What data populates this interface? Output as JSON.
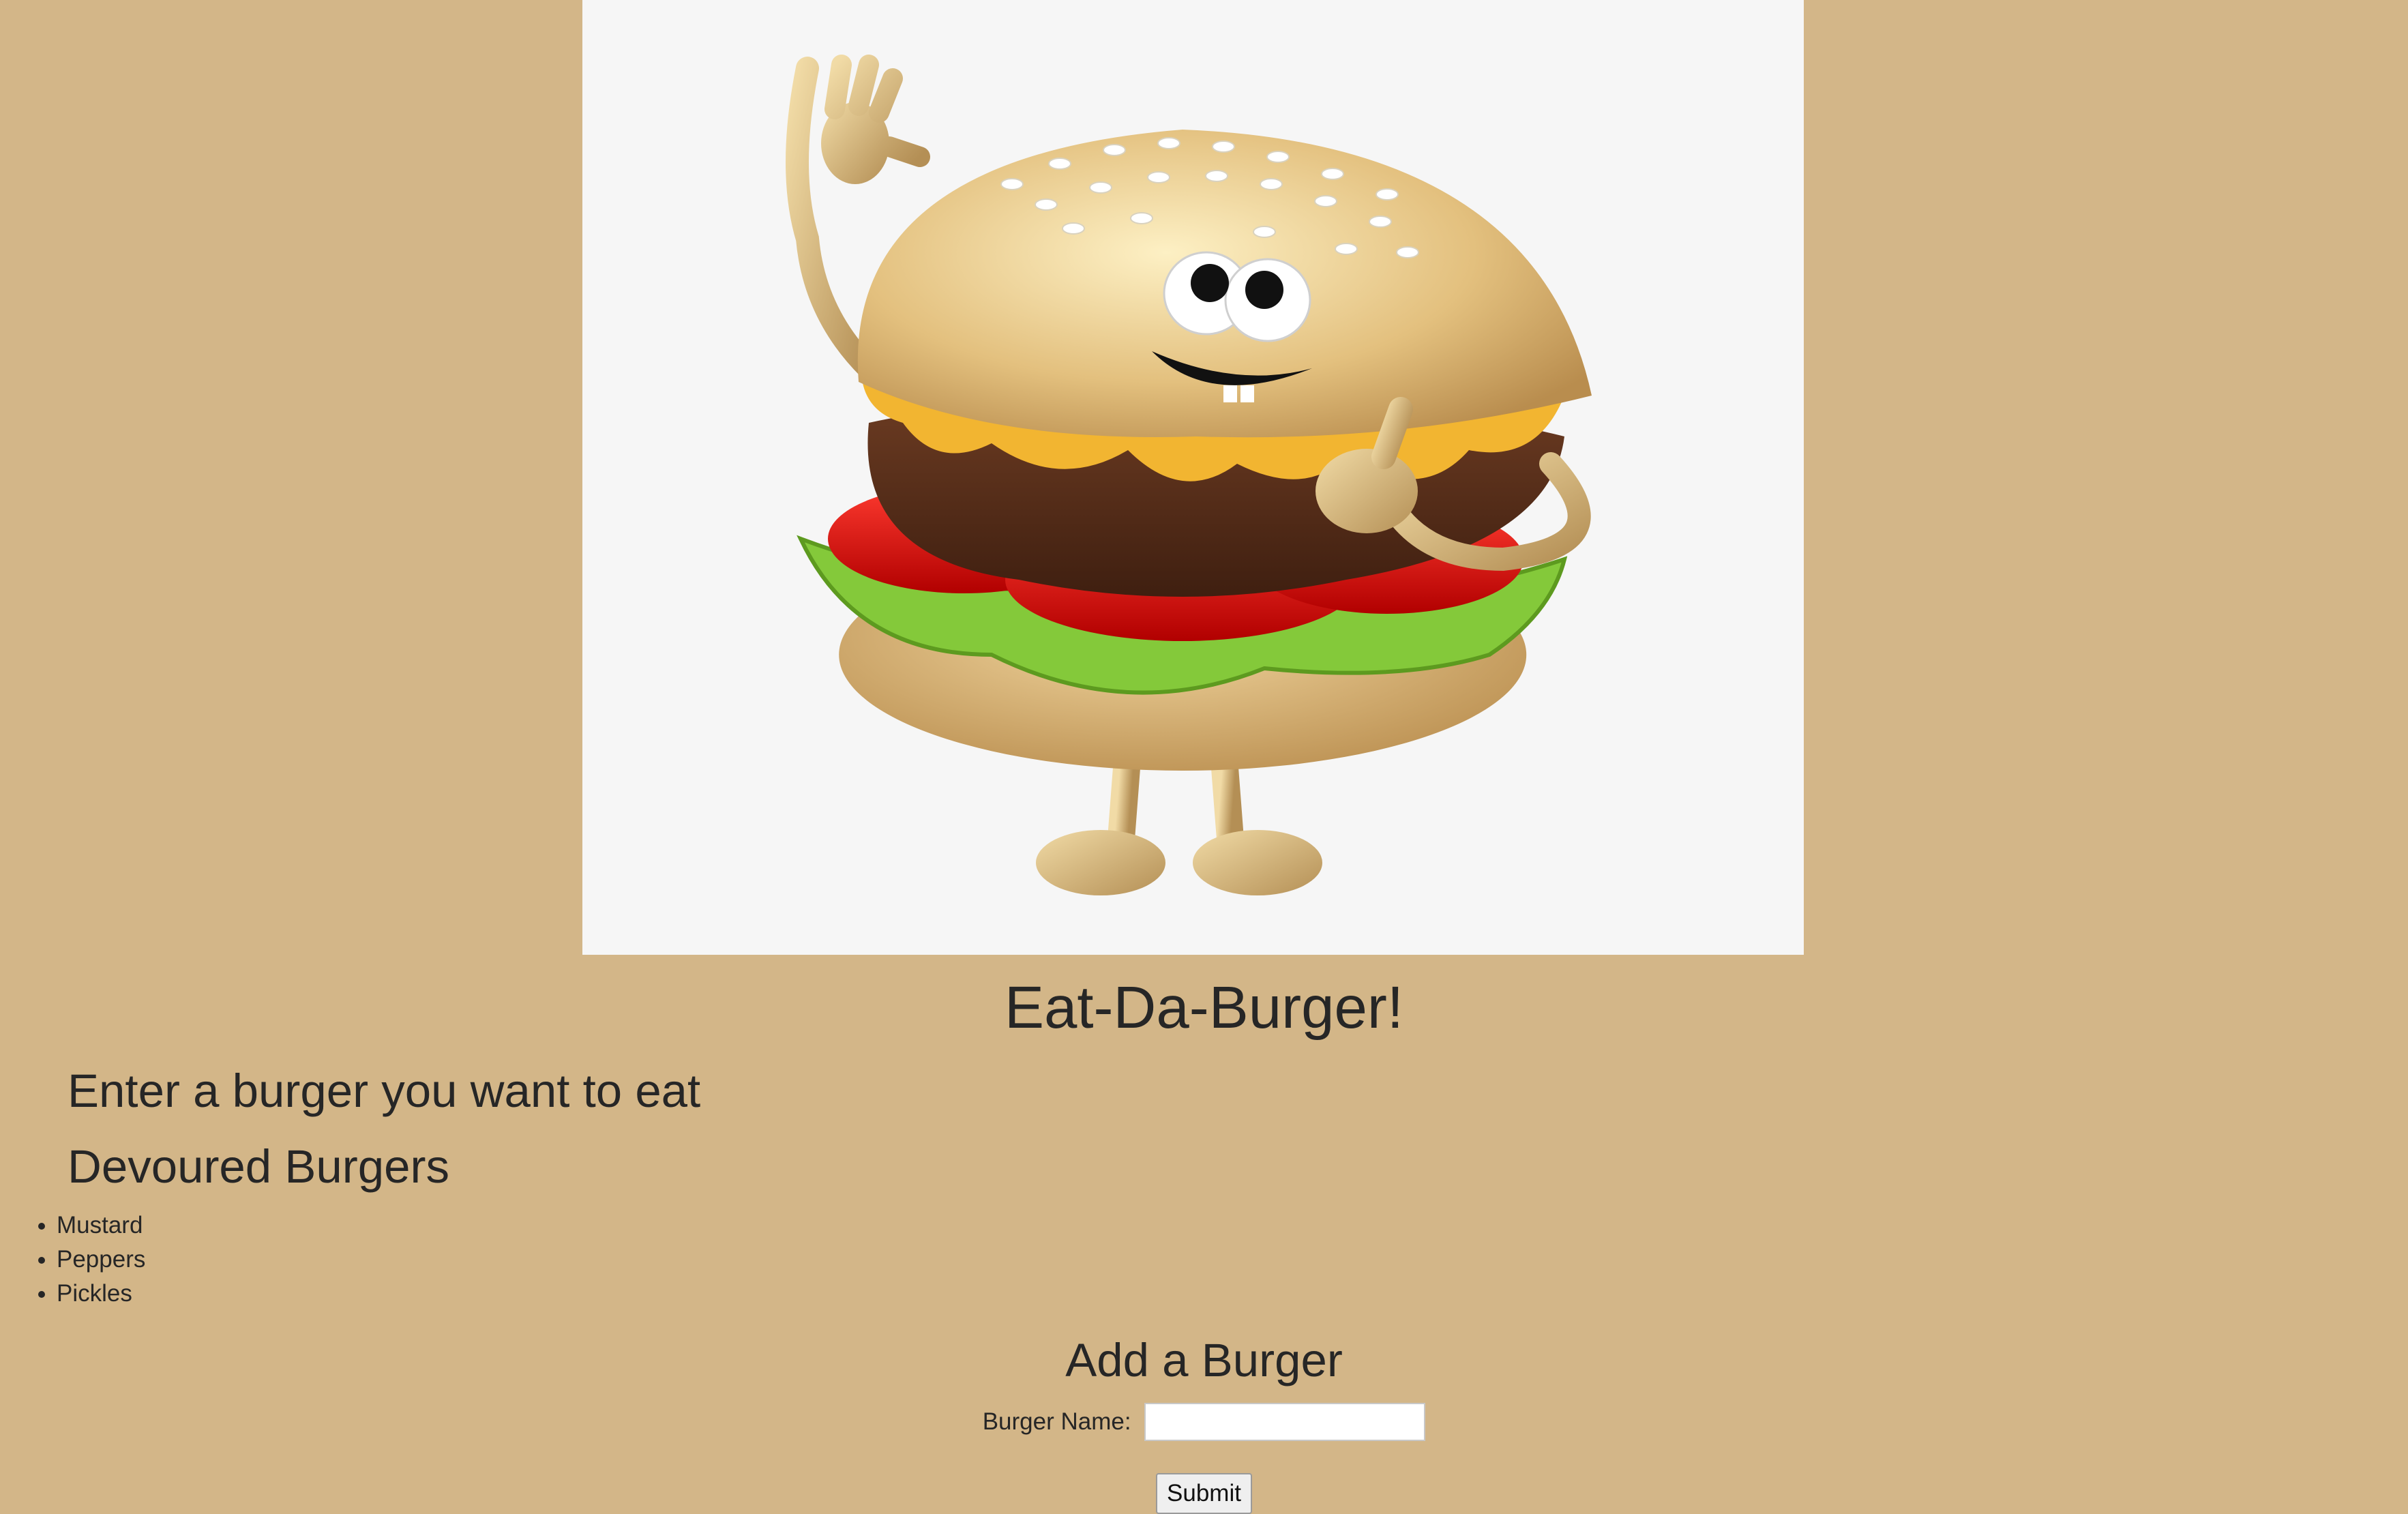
{
  "page": {
    "title": "Eat-Da-Burger!",
    "enter_heading": "Enter a burger you want to eat",
    "devoured_heading": "Devoured Burgers"
  },
  "devoured": [
    "Mustard",
    "Peppers",
    "Pickles"
  ],
  "form": {
    "heading": "Add a Burger",
    "label": "Burger Name:",
    "input_value": "",
    "submit_label": "Submit"
  },
  "hero": {
    "image": "cartoon-burger-mascot"
  },
  "colors": {
    "background": "#d3b688",
    "hero_background": "#f6f6f6",
    "text": "#262626"
  }
}
